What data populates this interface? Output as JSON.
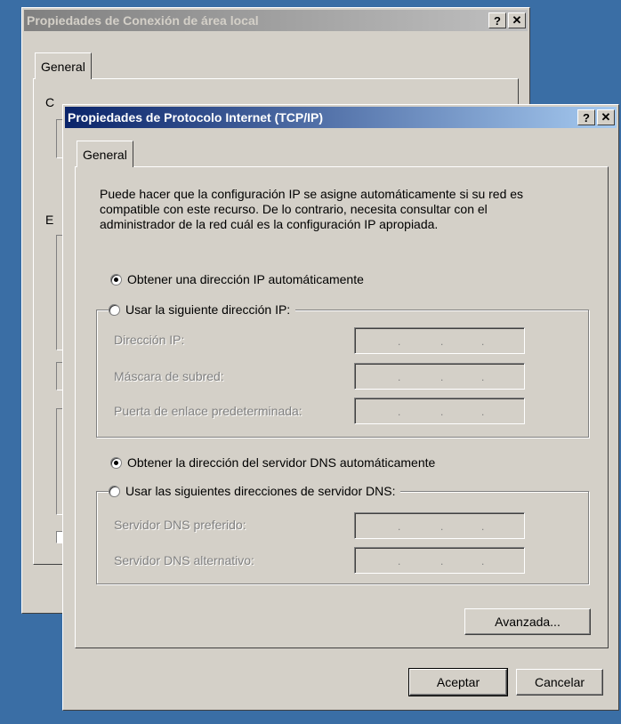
{
  "back_window": {
    "title": "Propiedades de Conexión de área local",
    "help_btn": "?",
    "close_btn": "✕",
    "tab_general": "General",
    "frag_1": "C",
    "frag_2": "E"
  },
  "front_window": {
    "title": "Propiedades de Protocolo Internet (TCP/IP)",
    "help_btn": "?",
    "close_btn": "✕",
    "tab_general": "General",
    "description": "Puede hacer que la configuración IP se asigne automáticamente si su red es compatible con este recurso. De lo contrario, necesita consultar con el administrador de la red cuál es la configuración IP apropiada.",
    "ip_auto_label": "Obtener una dirección IP automáticamente",
    "ip_auto_checked": true,
    "ip_manual_label": "Usar la siguiente dirección IP:",
    "ip_address_label": "Dirección IP:",
    "subnet_label": "Máscara de subred:",
    "gateway_label": "Puerta de enlace predeterminada:",
    "dns_auto_label": "Obtener la dirección del servidor DNS automáticamente",
    "dns_auto_checked": true,
    "dns_manual_label": "Usar las siguientes direcciones de servidor DNS:",
    "dns_preferred_label": "Servidor DNS preferido:",
    "dns_alternate_label": "Servidor DNS alternativo:",
    "ip_dot": ".",
    "advanced_button": "Avanzada...",
    "ok_button": "Aceptar",
    "cancel_button": "Cancelar"
  }
}
